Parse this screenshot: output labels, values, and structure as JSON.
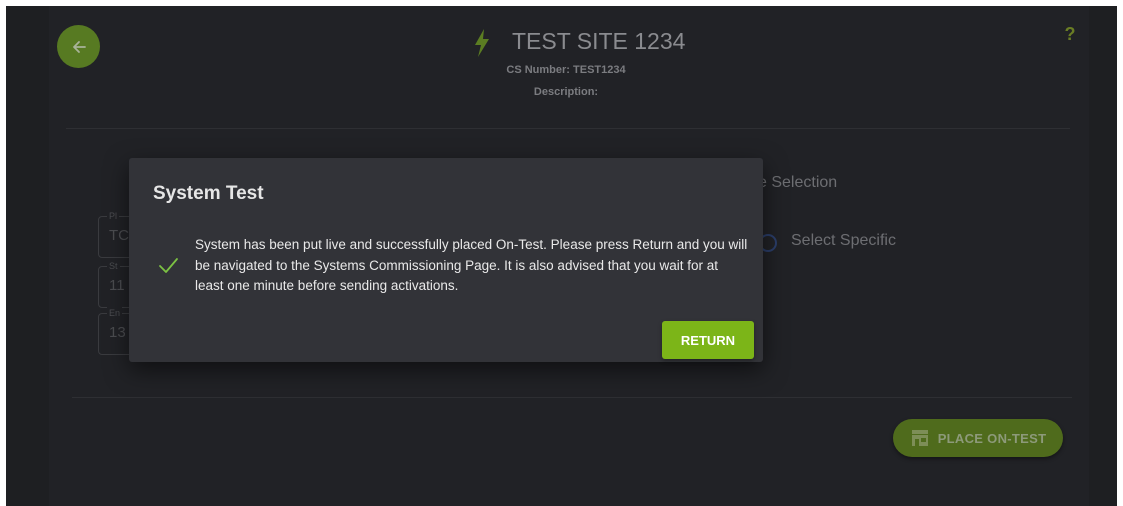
{
  "header": {
    "title": "TEST SITE 1234",
    "cs_number": "CS Number: TEST1234",
    "description": "Description:",
    "help": "?",
    "icons": {
      "back": "arrow-left-icon",
      "site": "lightning-bolt-icon",
      "help": "question-mark-icon"
    }
  },
  "form": {
    "fields": [
      {
        "label": "Pl",
        "value": "TC"
      },
      {
        "label": "St",
        "value": "11"
      },
      {
        "label": "En",
        "value": "13"
      }
    ],
    "selection_label": "e Selection",
    "select_specific_label": "Select Specific"
  },
  "actions": {
    "place_on_test_label": "PLACE ON-TEST",
    "place_on_test_icon": "store-icon"
  },
  "dialog": {
    "title": "System Test",
    "message": "System has been put live and successfully placed On-Test. Please press Return and you will be navigated to the Systems Commissioning Page. It is also advised that you wait for at least one minute before sending activations.",
    "icon": "check-icon",
    "return_label": "RETURN"
  },
  "colors": {
    "accent_green": "#7cb518",
    "back_button": "#577a22",
    "background": "#1e1f22",
    "dialog": "#323338"
  }
}
